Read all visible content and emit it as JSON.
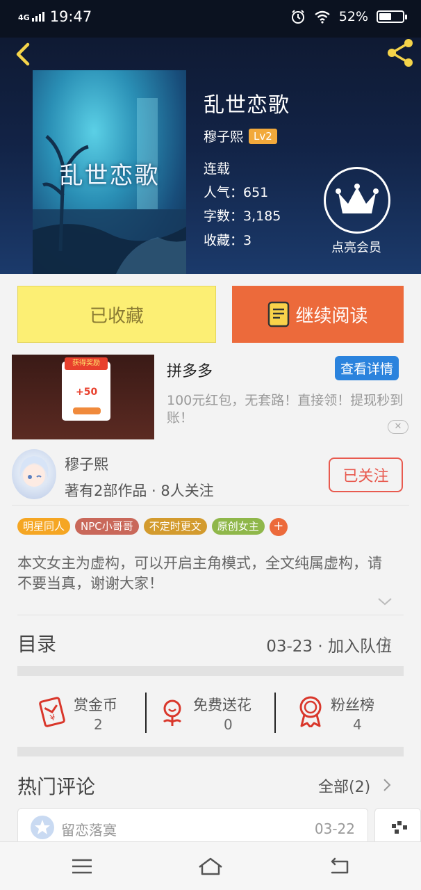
{
  "status_bar": {
    "network": "4G",
    "time": "19:47",
    "battery_percent": "52%",
    "battery_level": 0.52,
    "icons": [
      "signal-icon",
      "alarm-icon",
      "wifi-icon",
      "battery-icon"
    ]
  },
  "header": {
    "icons": {
      "back": "back-arrow-icon",
      "share": "share-icon"
    },
    "cover_title": "乱世恋歌",
    "title": "乱世恋歌",
    "author": "穆子熙",
    "level": "Lv2",
    "status": "连载",
    "popularity": "人气：651",
    "word_count": "字数：3,185",
    "favorites": "收藏：3",
    "vip_label": "点亮会员",
    "colors": {
      "accent_yellow": "#f5d44a",
      "level_badge": "#f2a93b"
    }
  },
  "actions": {
    "collected_label": "已收藏",
    "read_label": "继续阅读",
    "colors": {
      "collected_bg": "#fcef74",
      "read_bg": "#ec6a3b"
    }
  },
  "ad": {
    "image_ribbon": "获得奖励",
    "image_amount": "+50",
    "title": "拼多多",
    "detail_button": "查看详情",
    "description": "100元红包，无套路！直接领！提现秒到账！",
    "close_symbol": "✕"
  },
  "author_section": {
    "name": "穆子熙",
    "info": "著有2部作品 · 8人关注",
    "follow_label": "已关注"
  },
  "tags": [
    {
      "label": "明星同人",
      "color": "#f5a623"
    },
    {
      "label": "NPC小哥哥",
      "color": "#c9685a"
    },
    {
      "label": "不定时更文",
      "color": "#d39b2e"
    },
    {
      "label": "原创女主",
      "color": "#8fb74a"
    }
  ],
  "tag_more": "+",
  "description": "本文女主为虚构，可以开启主角模式，全文纯属虚构，请不要当真，谢谢大家！",
  "toc": {
    "label": "目录",
    "latest": "03-23 · 加入队伍"
  },
  "stats": [
    {
      "label": "赏金币",
      "value": "2",
      "icon": "red-envelope-icon"
    },
    {
      "label": "免费送花",
      "value": "0",
      "icon": "flower-icon"
    },
    {
      "label": "粉丝榜",
      "value": "4",
      "icon": "medal-icon"
    }
  ],
  "comments": {
    "label": "热门评论",
    "all_label": "全部(2)",
    "items": [
      {
        "user": "留恋落寞",
        "date": "03-22"
      }
    ]
  },
  "navbar": {
    "icons": [
      "menu-icon",
      "home-icon",
      "back-icon"
    ]
  }
}
